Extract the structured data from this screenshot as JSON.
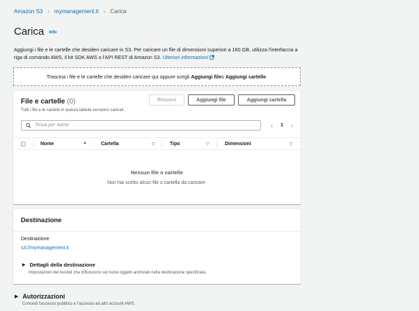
{
  "breadcrumb": {
    "items": [
      "Amazon S3",
      "mymanagement.it",
      "Carica"
    ]
  },
  "page": {
    "title": "Carica",
    "info_label": "Info",
    "intro_text": "Aggiungi i file e le cartelle che desideri caricare in S3. Per caricare un file di dimensioni superiori a 160 GB, utilizza l'interfaccia a riga di comando AWS, il kit SDK AWS o l'API REST di Amazon S3. ",
    "intro_link": "Ulteriori informazioni"
  },
  "dropzone": {
    "prefix": "Trascina i file e le cartelle che desideri caricare qui oppure scegli ",
    "add_files": "Aggiungi file",
    "middle": " o ",
    "add_folder": "Aggiungi cartelle",
    "suffix": "."
  },
  "files_panel": {
    "title": "File e cartelle",
    "count": "(0)",
    "subtitle": "Tutti i file e le cartelle in questa tabella verranno caricati.",
    "remove_button": "Rimuovi",
    "add_files_button": "Aggiungi file",
    "add_folder_button": "Aggiungi cartella",
    "search_placeholder": "Trova per nome",
    "page_number": "1",
    "columns": [
      "Nome",
      "Cartella",
      "Tipo",
      "Dimensioni"
    ],
    "empty_title": "Nessun file o cartelle",
    "empty_subtitle": "Non hai scelto alcun file o cartella da caricare."
  },
  "destination_panel": {
    "title": "Destinazione",
    "label": "Destinazione",
    "value": "s3://mymanagement.it",
    "details_title": "Dettagli della destinazione",
    "details_subtitle": "Impostazioni del bucket che influiscono sui nuovi oggetti archiviati nella destinazione specificata."
  },
  "permissions": {
    "title": "Autorizzazioni",
    "subtitle": "Concedi l'accesso pubblico e l'accesso ad altri account AWS."
  },
  "icons": {
    "chevron": "chevron-right-icon",
    "external": "external-link-icon",
    "search": "search-icon",
    "caret": "caret-right-icon"
  },
  "colors": {
    "link": "#0073bb",
    "background": "#f2f3f3",
    "panel": "#ffffff",
    "text": "#16191f",
    "muted": "#545b64"
  }
}
